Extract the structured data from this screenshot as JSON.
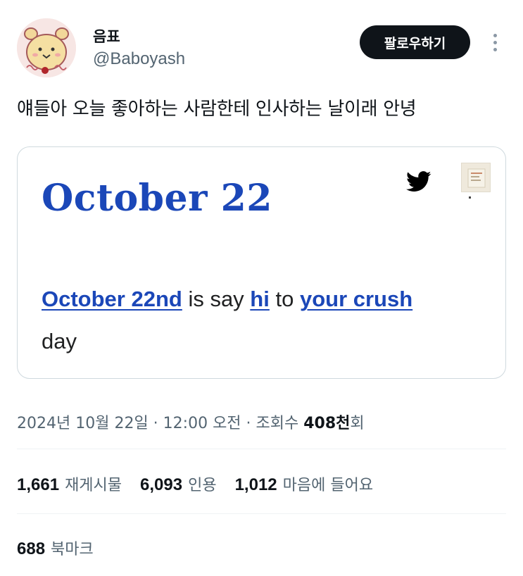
{
  "user": {
    "display_name": "음표",
    "handle": "@Baboyash",
    "avatar_icon": "bear-character-avatar"
  },
  "actions": {
    "follow_label": "팔로우하기",
    "more_icon": "more-vertical-icon"
  },
  "tweet": {
    "text": "얘들아 오늘 좋아하는 사람한테 인사하는 날이래 안녕"
  },
  "card": {
    "title": "October 22",
    "link_date": "October 22nd",
    "text_is_say": " is say ",
    "link_hi": "hi",
    "text_to": " to ",
    "link_crush": "your crush",
    "text_day": "day",
    "source_icon": "twitter-bird-icon",
    "accent_color": "#1b47b8"
  },
  "meta": {
    "date": "2024년 10월 22일",
    "sep1": " · ",
    "time": "12:00 오전",
    "sep2": " · ",
    "views_label": "조회수 ",
    "views_count": "408천",
    "views_suffix": "회"
  },
  "stats": {
    "reposts_count": "1,661",
    "reposts_label": "재게시물",
    "quotes_count": "6,093",
    "quotes_label": "인용",
    "likes_count": "1,012",
    "likes_label": "마음에 들어요",
    "bookmarks_count": "688",
    "bookmarks_label": "북마크"
  }
}
